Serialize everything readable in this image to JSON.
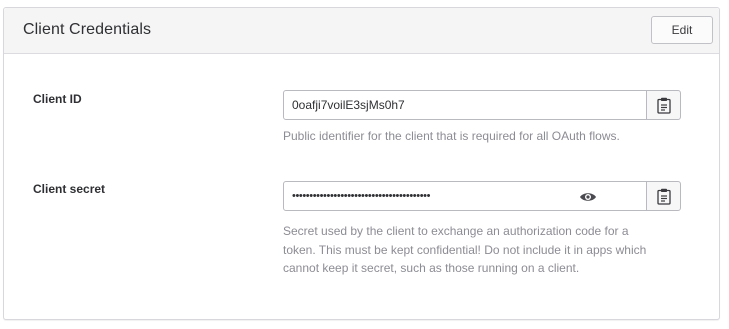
{
  "panel": {
    "title": "Client Credentials",
    "edit_label": "Edit"
  },
  "client_id": {
    "label": "Client ID",
    "value": "0oafji7voilE3sjMs0h7",
    "help": "Public identifier for the client that is required for all OAuth flows.",
    "copy_icon": "clipboard-icon"
  },
  "client_secret": {
    "label": "Client secret",
    "masked_value": "••••••••••••••••••••••••••••••••••••••••",
    "reveal_icon": "eye-icon",
    "copy_icon": "clipboard-icon",
    "help_lines": [
      "Secret used by the client to exchange an authorization code for a",
      "token. This must be kept confidential! Do not include it in apps which",
      "cannot keep it secret, such as those running on a client."
    ]
  },
  "colors": {
    "header_bg": "#f5f5f6",
    "border": "#d7d7dc",
    "help_text": "#8c8c94",
    "label_text": "#2f3033"
  }
}
